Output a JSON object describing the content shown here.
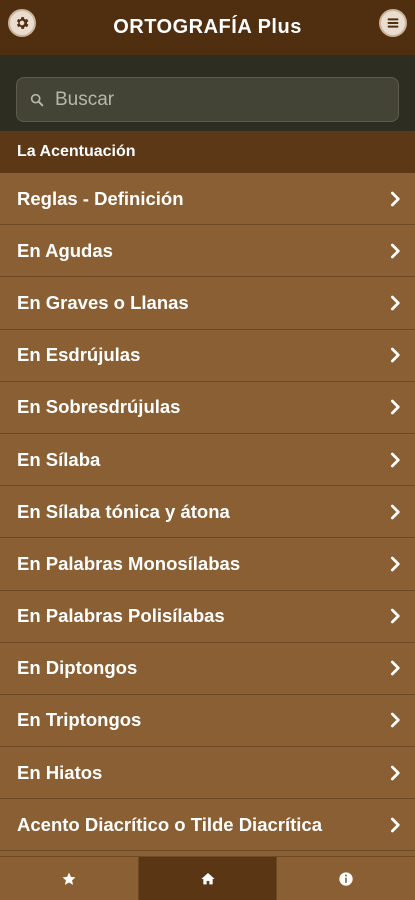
{
  "header": {
    "title": "ORTOGRAFÍA Plus",
    "settings_icon": "gear-icon",
    "menu_icon": "hamburger-menu-icon"
  },
  "search": {
    "placeholder": "Buscar",
    "value": ""
  },
  "section": {
    "title": "La Acentuación"
  },
  "items": [
    {
      "label": "Reglas - Definición"
    },
    {
      "label": "En Agudas"
    },
    {
      "label": "En Graves o Llanas"
    },
    {
      "label": "En Esdrújulas"
    },
    {
      "label": "En Sobresdrújulas"
    },
    {
      "label": "En Sílaba"
    },
    {
      "label": "En Sílaba tónica y átona"
    },
    {
      "label": "En Palabras Monosílabas"
    },
    {
      "label": "En Palabras Polisílabas"
    },
    {
      "label": "En Diptongos"
    },
    {
      "label": "En Triptongos"
    },
    {
      "label": "En Hiatos"
    },
    {
      "label": "Acento Diacrítico o Tilde Diacrítica"
    }
  ],
  "bottom_nav": {
    "tabs": [
      {
        "icon": "star-icon",
        "active": false
      },
      {
        "icon": "home-icon",
        "active": true
      },
      {
        "icon": "info-icon",
        "active": false
      }
    ]
  },
  "colors": {
    "header_bg": "#4f2f10",
    "search_band_bg": "#2e2d22",
    "section_bg": "#5c3816",
    "list_bg": "#8a5f33",
    "active_tab_bg": "#5a3614"
  }
}
